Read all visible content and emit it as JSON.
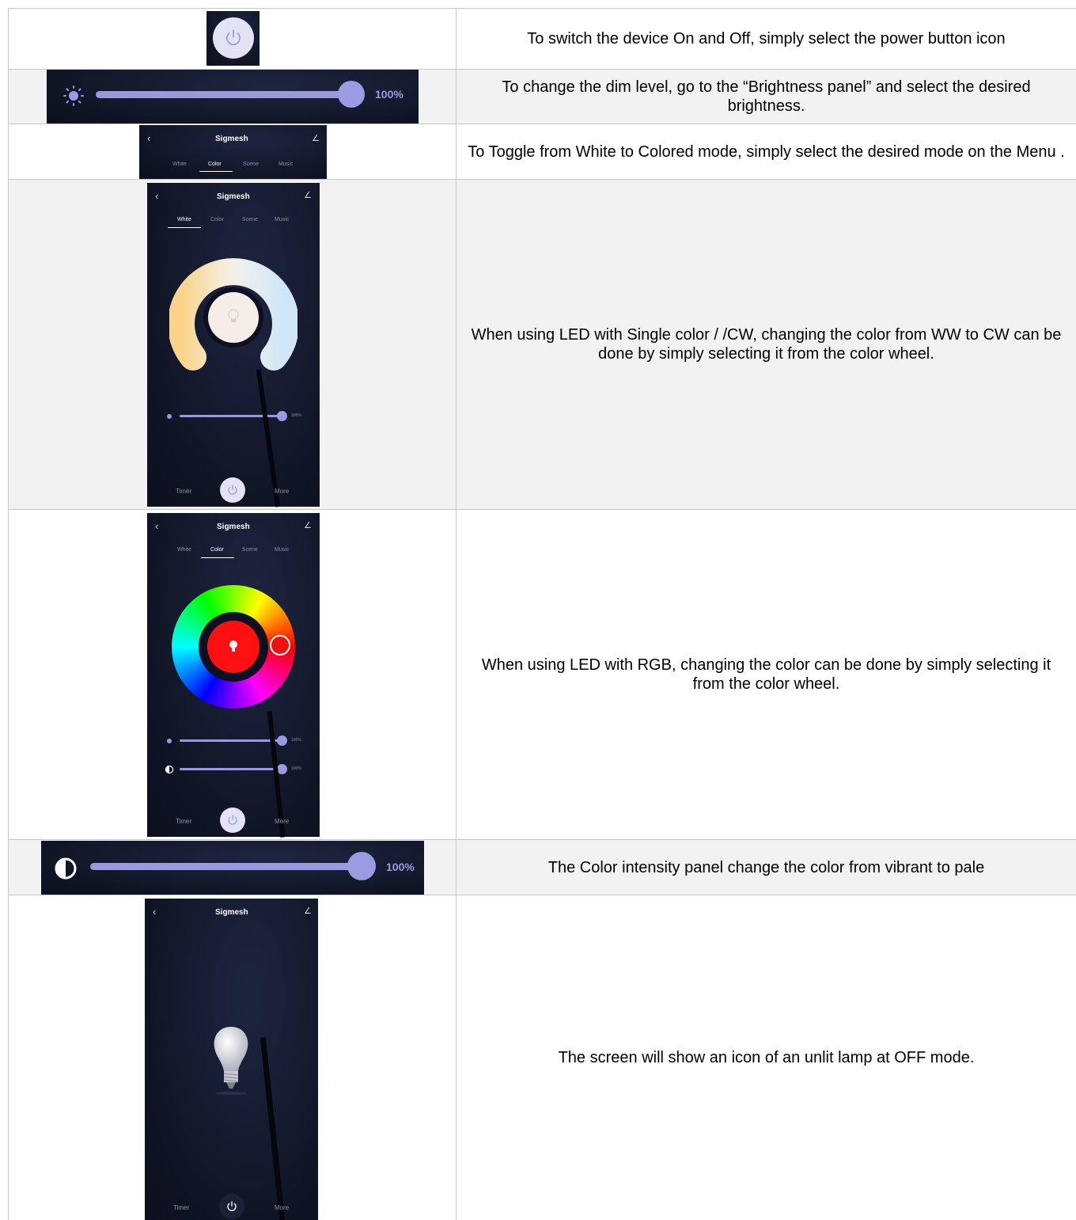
{
  "rows": [
    {
      "text": "To switch the device On and Off, simply select the power button icon"
    },
    {
      "text": "To change the dim level, go to the “Brightness panel” and select the desired brightness.",
      "slider_value": "100%"
    },
    {
      "text": "To Toggle from White to Colored mode, simply select the desired mode on the Menu .",
      "app_title": "Sigmesh",
      "tabs": [
        "White",
        "Color",
        "Scene",
        "Music"
      ],
      "active_tab": "Color"
    },
    {
      "text": "When using LED with Single color / /CW, changing the color from WW to CW can be done by simply selecting it from the color wheel.",
      "app_title": "Sigmesh",
      "tabs": [
        "White",
        "Color",
        "Scene",
        "Music"
      ],
      "active_tab": "White",
      "brightness": "100%",
      "bottom": {
        "left": "Timer",
        "right": "More"
      }
    },
    {
      "text": "When using LED with RGB, changing the color can be done by simply selecting it from the color wheel.",
      "app_title": "Sigmesh",
      "tabs": [
        "White",
        "Color",
        "Scene",
        "Music"
      ],
      "active_tab": "Color",
      "brightness": "100%",
      "intensity": "100%",
      "bottom": {
        "left": "Timer",
        "right": "More"
      }
    },
    {
      "text": "The Color intensity panel change the color from vibrant to pale",
      "slider_value": "100%"
    },
    {
      "text": "The screen will show an icon of an unlit lamp at OFF mode.",
      "app_title": "Sigmesh",
      "bottom": {
        "left": "Timer",
        "right": "More"
      }
    }
  ],
  "colors": {
    "accent": "#9a9ae6",
    "bg_dark": "#121729",
    "row_alt": "#f2f2f2"
  }
}
